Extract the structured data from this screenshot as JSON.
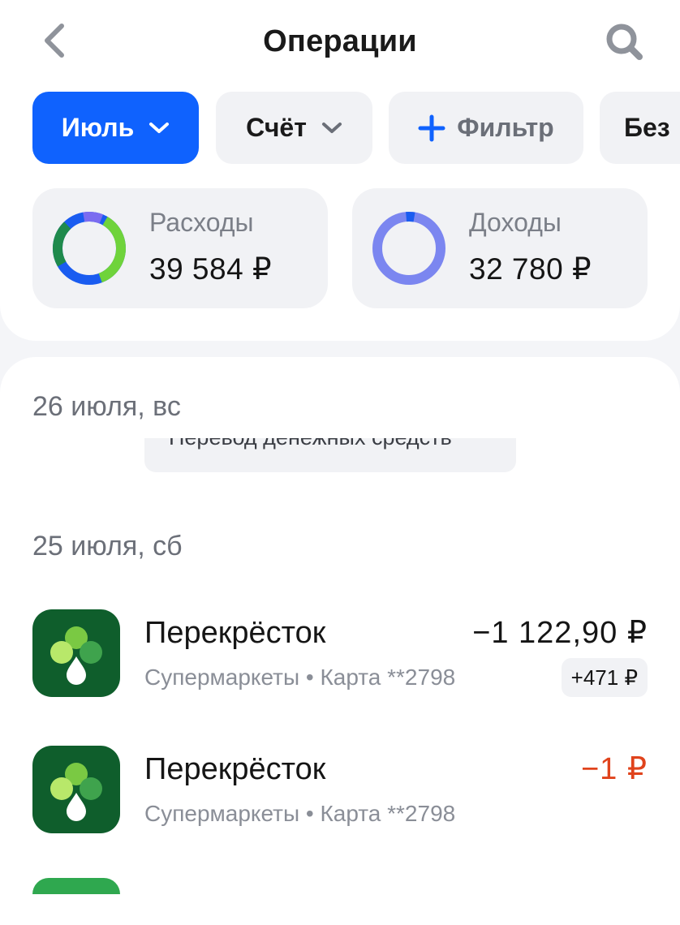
{
  "header": {
    "title": "Операции",
    "back_icon": "chevron-left-icon",
    "search_icon": "search-icon"
  },
  "filters": {
    "month": "Июль",
    "account": "Счёт",
    "filter": "Фильтр",
    "extra": "Без"
  },
  "summary": {
    "expenses": {
      "label": "Расходы",
      "value": "39 584 ₽"
    },
    "income": {
      "label": "Доходы",
      "value": "32 780 ₽"
    }
  },
  "colors": {
    "accent": "#0f62fe",
    "negative": "#e0431c",
    "donut_green": "#6fd33b",
    "donut_blue": "#1a5cf0",
    "donut_darkgreen": "#1f8a4c",
    "donut_purple": "#7b6cf0",
    "income_ring": "#7b86f0"
  },
  "groups": [
    {
      "date": "26 июля, вс",
      "partial_text": "Перевод денежных средств"
    },
    {
      "date": "25 июля, сб",
      "transactions": [
        {
          "merchant": "Перекрёсток",
          "category": "Супермаркеты • Карта **2798",
          "amount": "−1 122,90 ₽",
          "bonus": "+471 ₽",
          "icon": "perekrestok-logo-icon"
        },
        {
          "merchant": "Перекрёсток",
          "category": "Супермаркеты • Карта **2798",
          "amount": "−1 ₽",
          "icon": "perekrestok-logo-icon"
        }
      ]
    }
  ]
}
